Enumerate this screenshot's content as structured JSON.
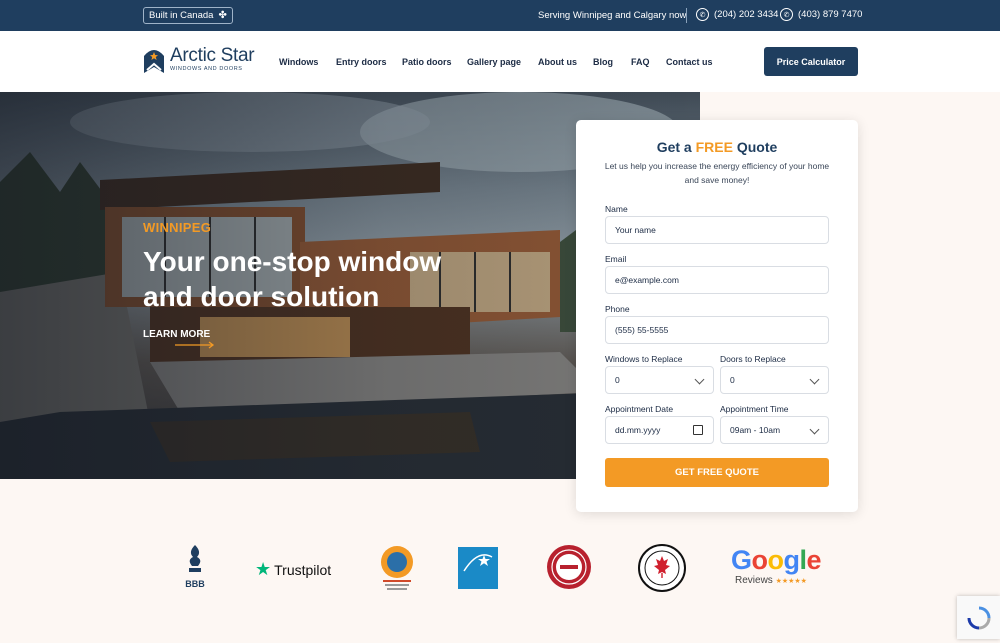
{
  "topbar": {
    "built_label": "Built in Canada",
    "built_icon": "maple-leaf-icon",
    "serving": "Serving Winnipeg and Calgary now",
    "phones": [
      "(204) 202 3434",
      "(403) 879 7470"
    ],
    "phone_icon": "phone-icon"
  },
  "brand": {
    "name": "Arctic Star",
    "tagline": "WINDOWS AND DOORS"
  },
  "nav": {
    "items": [
      "Windows",
      "Entry doors",
      "Patio doors",
      "Gallery page",
      "About us",
      "Blog",
      "FAQ",
      "Contact us"
    ],
    "cta": "Price Calculator"
  },
  "hero": {
    "city": "WINNIPEG",
    "headline": "Your one-stop window and door solution",
    "link": "LEARN MORE"
  },
  "quote": {
    "title_pre": "Get a ",
    "title_free": "FREE",
    "title_post": " Quote",
    "subtitle": "Let us help you increase the energy efficiency of your home and save money!",
    "name_label": "Name",
    "name_placeholder": "Your name",
    "email_label": "Email",
    "email_placeholder": "e@example.com",
    "phone_label": "Phone",
    "phone_placeholder": "(555) 55-5555",
    "windows_label": "Windows to Replace",
    "windows_value": "0",
    "doors_label": "Doors to Replace",
    "doors_value": "0",
    "date_label": "Appointment Date",
    "date_value": "dd.mm.yyyy",
    "time_label": "Appointment Time",
    "time_value": "09am - 10am",
    "submit": "GET FREE QUOTE"
  },
  "badges": {
    "bbb": "BBB",
    "trustpilot": "Trustpilot",
    "google": "Google",
    "google_reviews": "Reviews",
    "google_stars": "★★★★★"
  },
  "colors": {
    "navy": "#1f3e5f",
    "orange": "#f39a25"
  }
}
